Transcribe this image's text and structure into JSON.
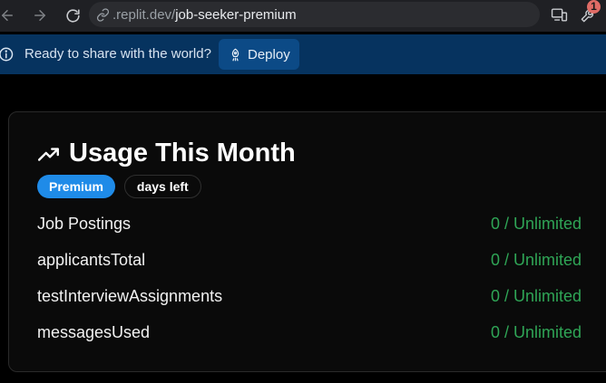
{
  "browser": {
    "url_host": ".replit.dev/",
    "url_path": "job-seeker-premium",
    "extension_badge": "1"
  },
  "banner": {
    "message": "Ready to share with the world?",
    "deploy_label": "Deploy"
  },
  "usage_card": {
    "title": "Usage This Month",
    "plan_badge": "Premium",
    "days_badge": "days left",
    "rows": [
      {
        "label": "Job Postings",
        "value": "0 / Unlimited"
      },
      {
        "label": "applicantsTotal",
        "value": "0 / Unlimited"
      },
      {
        "label": "testInterviewAssignments",
        "value": "0 / Unlimited"
      },
      {
        "label": "messagesUsed",
        "value": "0 / Unlimited"
      }
    ]
  },
  "colors": {
    "banner_bg": "#06335f",
    "deploy_button_bg": "#0c4a86",
    "plan_badge_bg": "#1f8be8",
    "usage_value": "#2fa556",
    "extension_badge_bg": "#e06c66"
  },
  "icons": [
    "back-icon",
    "forward-icon",
    "reload-icon",
    "link-icon",
    "device-icon",
    "extension-icon",
    "info-icon",
    "deploy-icon",
    "trending-up-icon"
  ]
}
